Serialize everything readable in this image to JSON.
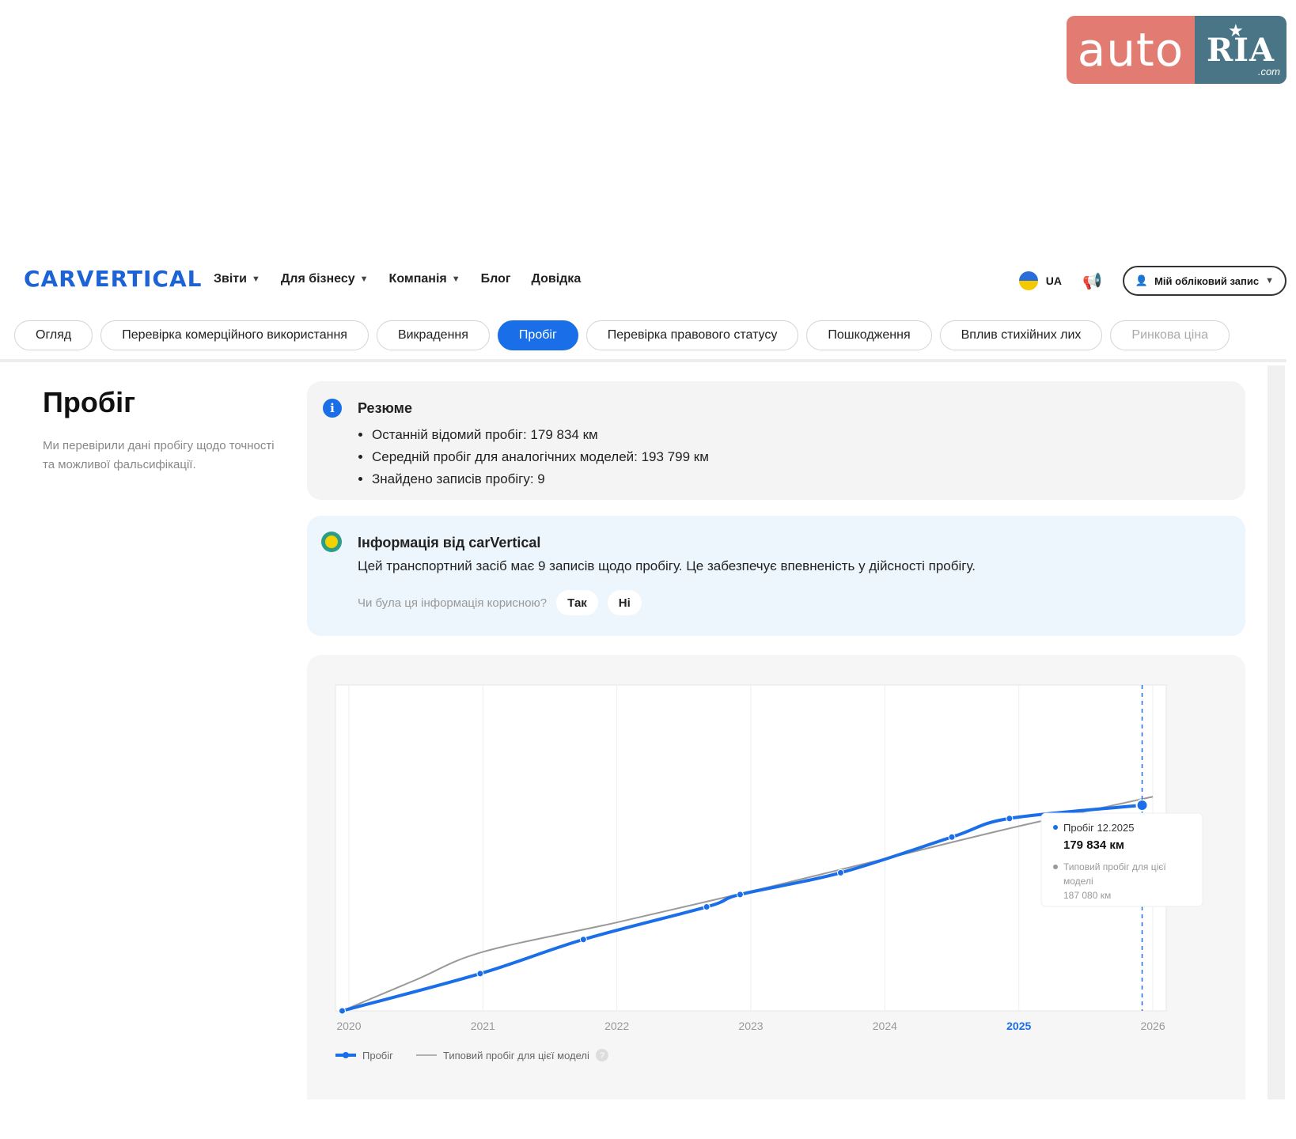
{
  "watermark": {
    "auto": "auto",
    "ria": "RIA",
    "com": ".com"
  },
  "nav": {
    "brand": "CARVERTICAL",
    "items": [
      {
        "label": "Звіти",
        "dropdown": true
      },
      {
        "label": "Для бізнесу",
        "dropdown": true
      },
      {
        "label": "Компанія",
        "dropdown": true
      },
      {
        "label": "Блог",
        "dropdown": false
      },
      {
        "label": "Довідка",
        "dropdown": false
      }
    ],
    "lang": "UA",
    "account": "Мій обліковий запис"
  },
  "tabs": [
    {
      "label": "Огляд",
      "active": false
    },
    {
      "label": "Перевірка комерційного використання",
      "active": false
    },
    {
      "label": "Викрадення",
      "active": false
    },
    {
      "label": "Пробіг",
      "active": true
    },
    {
      "label": "Перевірка правового статусу",
      "active": false
    },
    {
      "label": "Пошкодження",
      "active": false
    },
    {
      "label": "Вплив стихійних лих",
      "active": false
    },
    {
      "label": "Ринкова ціна",
      "active": false
    }
  ],
  "section": {
    "title": "Пробіг",
    "description": "Ми перевірили дані пробігу щодо точності та можливої фальсифікації."
  },
  "summary": {
    "title": "Резюме",
    "bullets": [
      "Останній відомий пробіг: 179 834 км",
      "Середній пробіг для аналогічних моделей: 193 799 км",
      "Знайдено записів пробігу: 9"
    ]
  },
  "info": {
    "title": "Інформація від carVertical",
    "text": "Цей транспортний засіб має 9 записів щодо пробігу. Це забезпечує впевненість у дійсності пробігу.",
    "question": "Чи була ця інформація корисною?",
    "yes": "Так",
    "no": "Ні"
  },
  "colors": {
    "accent": "#1a6ee8",
    "typical": "#9a9a9a"
  },
  "chart_data": {
    "type": "line",
    "x_ticks": [
      "2020",
      "2021",
      "2022",
      "2023",
      "2024",
      "2025",
      "2026"
    ],
    "highlight_tick": "2025",
    "xlim": [
      2019.9,
      2026.1
    ],
    "ylim": [
      0,
      210000
    ],
    "series": [
      {
        "name": "Пробіг",
        "x": [
          2019.95,
          2020.98,
          2021.75,
          2022.67,
          2022.92,
          2023.67,
          2024.5,
          2024.93,
          2025.92
        ],
        "y": [
          0,
          24000,
          46000,
          67000,
          75000,
          89000,
          112000,
          124000,
          132500
        ]
      },
      {
        "name": "Типовий пробіг для цієї моделі",
        "x": [
          2019.95,
          2020.5,
          2021.0,
          2022.0,
          2023.0,
          2024.0,
          2025.0,
          2026.0
        ],
        "y": [
          0,
          20000,
          38000,
          57000,
          77000,
          98000,
          119000,
          138000
        ]
      }
    ],
    "tooltip": {
      "label": "Пробіг 12.2025",
      "value": "179 834 км",
      "typical_label": "Типовий пробіг для цієї моделі",
      "typical_value": "187 080 км"
    },
    "legend": {
      "placement": "bottom-left"
    }
  }
}
